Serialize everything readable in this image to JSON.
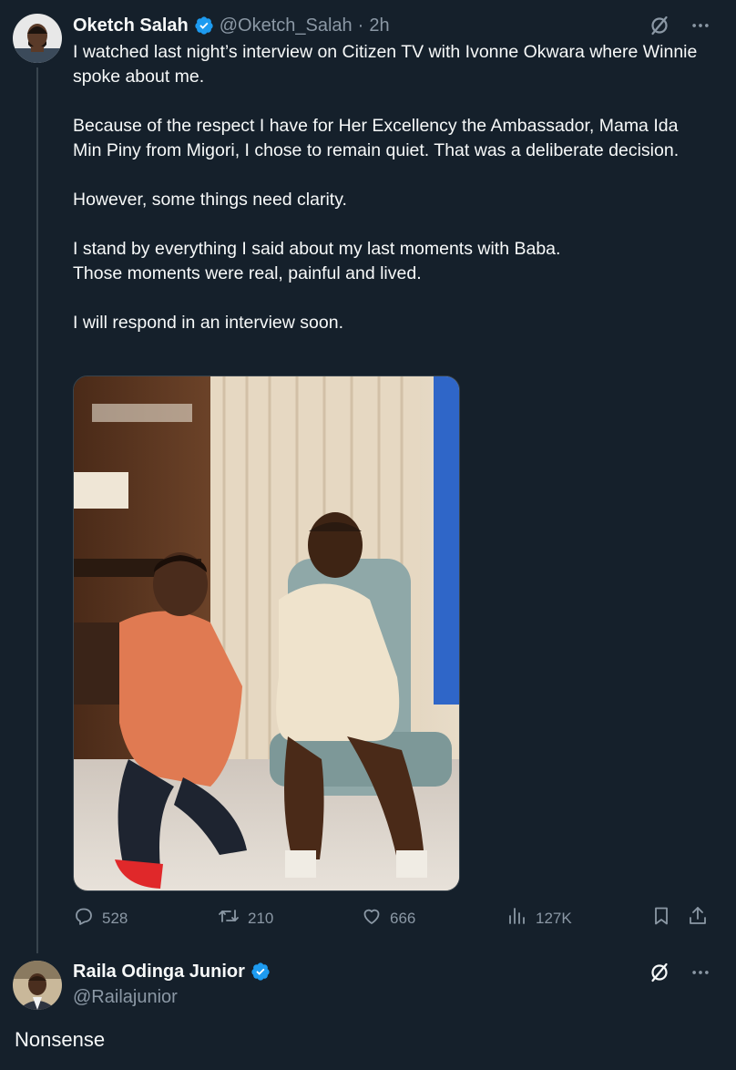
{
  "main_tweet": {
    "author_name": "Oketch Salah",
    "author_handle": "@Oketch_Salah",
    "time_sep": "·",
    "time": "2h",
    "paragraphs": [
      "I watched last night’s interview on Citizen TV with Ivonne Okwara where Winnie spoke about me.",
      "Because of the respect I have for Her Excellency the Ambassador, Mama Ida Min Piny from Migori, I chose to remain quiet. That was a deliberate decision.",
      "However, some things need clarity.",
      "I stand by everything I said about my last moments with Baba.\nThose moments were real, painful and lived.",
      "I will respond in an interview soon."
    ],
    "stats": {
      "replies": "528",
      "reposts": "210",
      "likes": "666",
      "views": "127K"
    }
  },
  "reply_tweet": {
    "author_name": "Raila Odinga Junior",
    "author_handle": "@Railajunior",
    "text": "Nonsense"
  },
  "icons": {
    "verified": "verified-badge-icon",
    "grok": "grok-icon",
    "more": "more-icon",
    "reply": "reply-icon",
    "repost": "repost-icon",
    "like": "like-icon",
    "views": "views-icon",
    "bookmark": "bookmark-icon",
    "share": "share-icon"
  },
  "colors": {
    "background": "#15202b",
    "text": "#f7f9f9",
    "muted": "#8b98a5",
    "verified": "#1d9bf0",
    "divider": "#38444d"
  }
}
